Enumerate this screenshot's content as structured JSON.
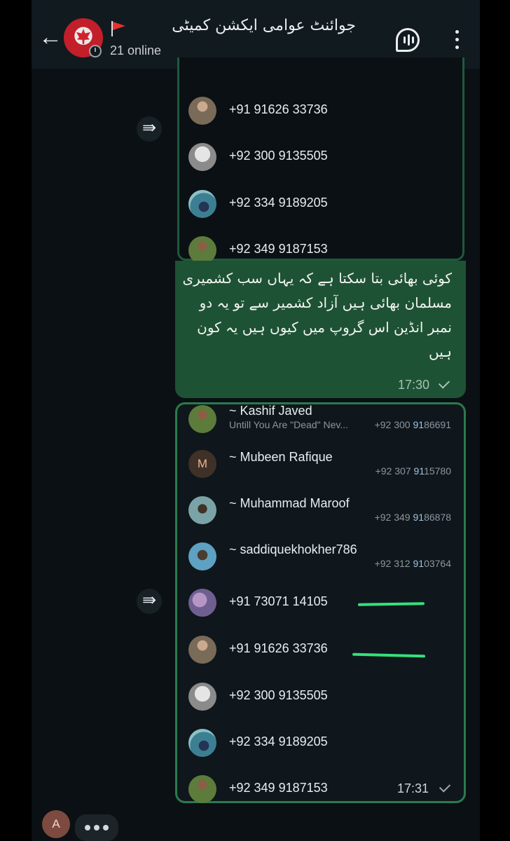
{
  "header": {
    "group_name": "جوائنٹ عوامی ایکشن کمیٹی",
    "online": "21 online"
  },
  "forward_block_1": {
    "contacts": [
      {
        "phone": "+91 91626 33736"
      },
      {
        "phone": "+92 300 9135505"
      },
      {
        "phone": "+92 334 9189205"
      },
      {
        "phone": "+92 349 9187153"
      }
    ]
  },
  "message": {
    "text": "کوئی بھائی بتا سکتا ہے کہ یہاں سب کشمیری مسلمان بھائی ہیں آزاد کشمیر سے تو یہ دو نمبر انڈین اس گروپ میں کیوں ہیں یہ کون ہیں",
    "time": "17:30"
  },
  "forward_block_2": {
    "members": [
      {
        "name": "~ Kashif Javed",
        "status": "Untill You Are \"Dead\" Nev...",
        "phone_prefix": "+92 300 ",
        "phone_hl": "91",
        "phone_suffix": "86691"
      },
      {
        "name": "~ Mubeen Rafique",
        "status": "",
        "phone_prefix": "+92 307 ",
        "phone_hl": "91",
        "phone_suffix": "15780",
        "avatar_letter": "M"
      },
      {
        "name": "~ Muhammad Maroof",
        "status": "",
        "phone_prefix": "+92 349 ",
        "phone_hl": "91",
        "phone_suffix": "86878"
      },
      {
        "name": "~ saddiquekhokher786",
        "status": "",
        "phone_prefix": "+92 312 ",
        "phone_hl": "91",
        "phone_suffix": "03764"
      }
    ],
    "contacts": [
      {
        "phone": "+91 73071 14105"
      },
      {
        "phone": "+91 91626 33736"
      },
      {
        "phone": "+92 300 9135505"
      },
      {
        "phone": "+92 334 9189205"
      },
      {
        "phone": "+92 349 9187153"
      }
    ],
    "time": "17:31"
  },
  "typing": {
    "avatar_letter": "A"
  },
  "colors": {
    "bubble_out": "#1e5234",
    "border_green": "#2b7a4c",
    "highlight": "#36e07c"
  }
}
